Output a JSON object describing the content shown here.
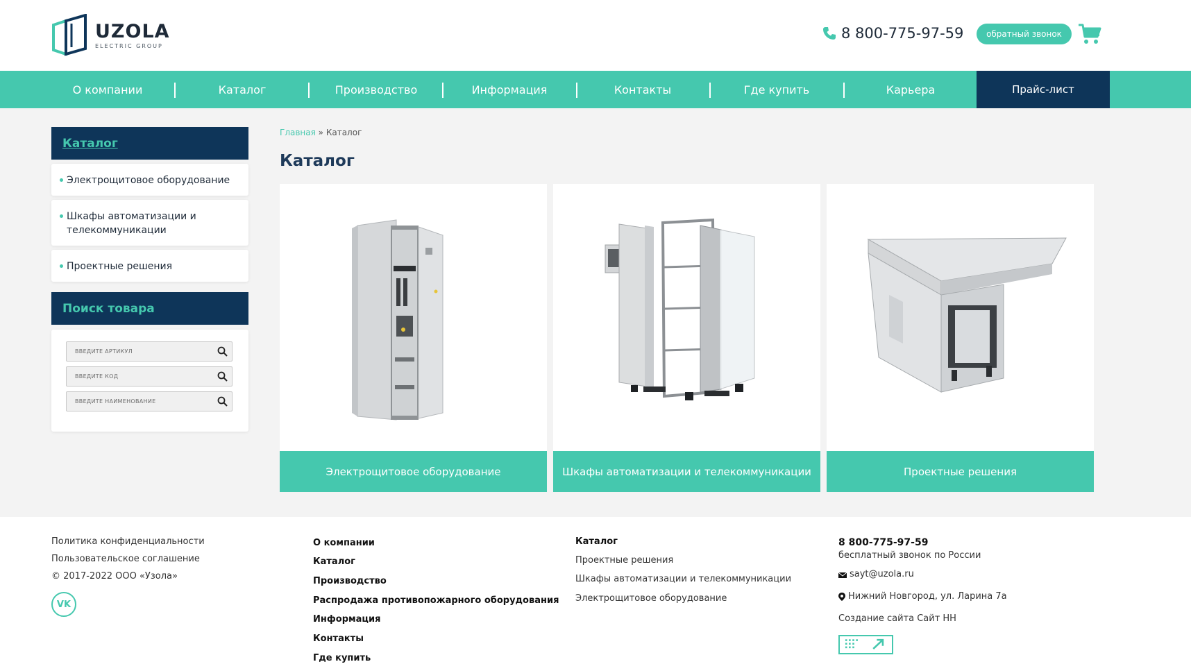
{
  "header": {
    "logo": {
      "name": "UZOLA",
      "sub": "ELECTRIC GROUP",
      "icon": "uzola-logo-icon"
    },
    "phone": "8 800-775-97-59",
    "callback_label": "обратный звонок",
    "icons": {
      "phone": "phone-icon",
      "cart": "cart-icon"
    }
  },
  "nav": {
    "items": [
      {
        "label": "О компании"
      },
      {
        "label": "Каталог"
      },
      {
        "label": "Производство"
      },
      {
        "label": "Информация"
      },
      {
        "label": "Контакты"
      },
      {
        "label": "Где купить"
      },
      {
        "label": "Карьера"
      }
    ],
    "price_label": "Прайс-лист"
  },
  "sidebar": {
    "catalog_title": "Каталог",
    "catalog_items": [
      {
        "label": "Электрощитовое оборудование"
      },
      {
        "label": "Шкафы автоматизации и телекоммуникации"
      },
      {
        "label": "Проектные решения"
      }
    ],
    "search_title": "Поиск товара",
    "search_fields": [
      {
        "placeholder": "введите артикул"
      },
      {
        "placeholder": "введите код"
      },
      {
        "placeholder": "введите наименование"
      }
    ]
  },
  "breadcrumb": {
    "home": "Главная",
    "sep": "»",
    "current": "Каталог"
  },
  "page_title": "Каталог",
  "cards": [
    {
      "caption": "Электрощитовое оборудование",
      "image": "switchboard-cabinet-image"
    },
    {
      "caption": "Шкафы автоматизации и телекоммуникации",
      "image": "telecom-cabinet-exploded-image"
    },
    {
      "caption": "Проектные решения",
      "image": "project-solution-cabinet-image"
    }
  ],
  "footer": {
    "legal": [
      "Политика конфиденциальности",
      "Пользовательское соглашение",
      "© 2017-2022 ООО «Узола»"
    ],
    "social": "VK",
    "nav": [
      "О компании",
      "Каталог",
      "Производство",
      "Распродажа противопожарного оборудования",
      "Информация",
      "Контакты",
      "Где купить"
    ],
    "catalog_title": "Каталог",
    "catalog": [
      "Проектные решения",
      "Шкафы автоматизации и телекоммуникации",
      "Электрощитовое оборудование"
    ],
    "phone": "8 800-775-97-59",
    "phone_note": "бесплатный звонок по России",
    "email": "sayt@uzola.ru",
    "address": "Нижний Новгород, ул. Ларина 7а",
    "made_by": "Создание сайта Сайт НН",
    "colors": {
      "accent": "#45c8ae",
      "navy": "#0e3559"
    }
  }
}
